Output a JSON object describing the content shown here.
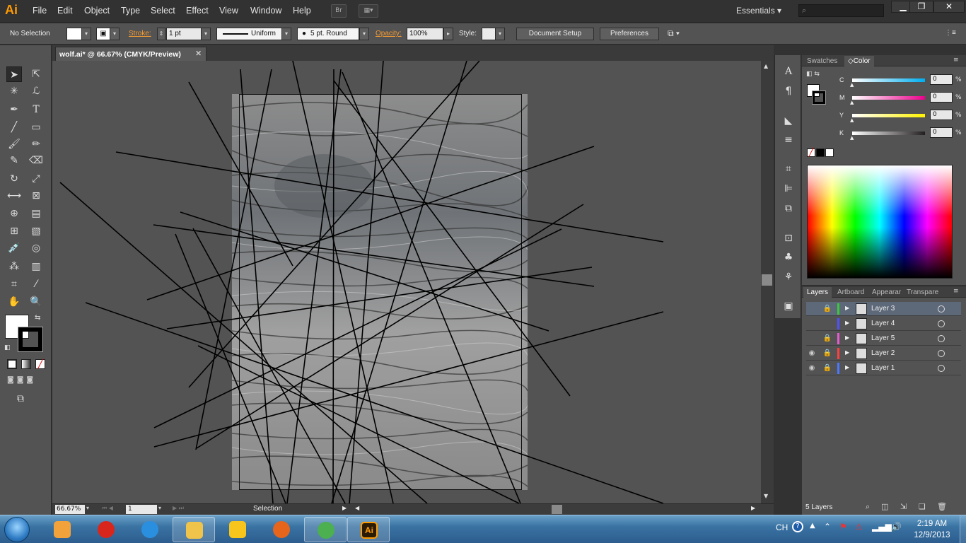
{
  "app": {
    "logo": "Ai"
  },
  "menu": [
    "File",
    "Edit",
    "Object",
    "Type",
    "Select",
    "Effect",
    "View",
    "Window",
    "Help"
  ],
  "bridge_label": "Br",
  "workspace": "Essentials",
  "search": {
    "placeholder": ""
  },
  "control": {
    "selection": "No Selection",
    "stroke_label": "Stroke:",
    "stroke_weight": "1 pt",
    "profile": "Uniform",
    "brush": "5 pt. Round",
    "opacity_label": "Opacity:",
    "opacity": "100%",
    "style_label": "Style:",
    "document_setup": "Document Setup",
    "preferences": "Preferences"
  },
  "document": {
    "tab_title": "wolf.ai* @ 66.67% (CMYK/Preview)",
    "zoom": "66.67%",
    "artboard_number": "1",
    "status": "Selection"
  },
  "color_panel": {
    "tabs": [
      "Swatches",
      "Color"
    ],
    "active_tab": "Color",
    "channels": [
      {
        "label": "C",
        "value": "0",
        "color": "#00aeef"
      },
      {
        "label": "M",
        "value": "0",
        "color": "#ec008c"
      },
      {
        "label": "Y",
        "value": "0",
        "color": "#fff200"
      },
      {
        "label": "K",
        "value": "0",
        "color": "#231f20"
      }
    ],
    "percent_sign": "%"
  },
  "layers_panel": {
    "tabs": [
      "Layers",
      "Artboard",
      "Appearar",
      "Transpare"
    ],
    "active_tab": "Layers",
    "layers": [
      {
        "name": "Layer 3",
        "color": "#3cc83c",
        "visible": false,
        "locked": true,
        "active": true
      },
      {
        "name": "Layer 4",
        "color": "#5050ff",
        "visible": false,
        "locked": false,
        "active": false
      },
      {
        "name": "Layer 5",
        "color": "#e65ad2",
        "visible": false,
        "locked": true,
        "active": false
      },
      {
        "name": "Layer 2",
        "color": "#ff4040",
        "visible": true,
        "locked": true,
        "active": false
      },
      {
        "name": "Layer 1",
        "color": "#4a78ff",
        "visible": true,
        "locked": true,
        "active": false
      }
    ],
    "count": "5 Layers"
  },
  "taskbar": {
    "items": [
      {
        "name": "media-player",
        "color": "#f2a23a"
      },
      {
        "name": "qq-player",
        "color": "#d9261c"
      },
      {
        "name": "internet-explorer",
        "color": "#2b8fe0"
      },
      {
        "name": "file-explorer",
        "color": "#f0c44a"
      },
      {
        "name": "pps-player",
        "color": "#f7c51c"
      },
      {
        "name": "firefox",
        "color": "#e6651c"
      },
      {
        "name": "chrome",
        "color": "#4caf50"
      },
      {
        "name": "illustrator",
        "color": "#ff9a00"
      }
    ],
    "language": "CH",
    "time": "2:19 AM",
    "date": "12/9/2013"
  }
}
